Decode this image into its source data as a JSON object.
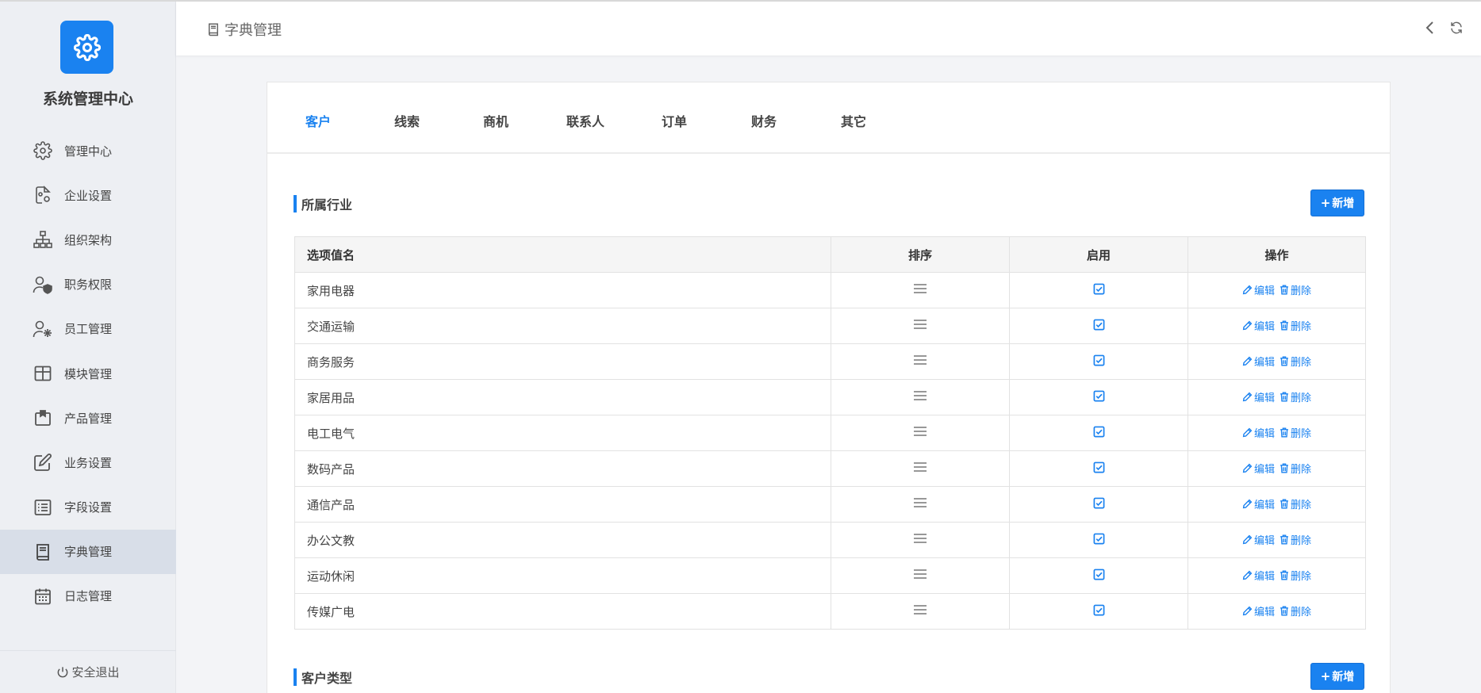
{
  "app": {
    "title": "系统管理中心",
    "logout": "安全退出"
  },
  "colors": {
    "accent": "#1a82f0",
    "sidebar_bg": "#edeff3",
    "sidebar_active": "#d8dee8"
  },
  "sidebar": {
    "items": [
      {
        "label": "管理中心",
        "icon": "gear-icon"
      },
      {
        "label": "企业设置",
        "icon": "document-gear-icon"
      },
      {
        "label": "组织架构",
        "icon": "org-chart-icon"
      },
      {
        "label": "职务权限",
        "icon": "user-shield-icon"
      },
      {
        "label": "员工管理",
        "icon": "user-gear-icon"
      },
      {
        "label": "模块管理",
        "icon": "grid-table-icon"
      },
      {
        "label": "产品管理",
        "icon": "box-icon"
      },
      {
        "label": "业务设置",
        "icon": "edit-icon"
      },
      {
        "label": "字段设置",
        "icon": "list-icon"
      },
      {
        "label": "字典管理",
        "icon": "book-icon",
        "active": true
      },
      {
        "label": "日志管理",
        "icon": "calendar-icon"
      }
    ]
  },
  "header": {
    "breadcrumb": "字典管理",
    "back_icon": "chevron-left-icon",
    "refresh_icon": "refresh-icon"
  },
  "tabs": [
    {
      "label": "客户",
      "active": true
    },
    {
      "label": "线索"
    },
    {
      "label": "商机"
    },
    {
      "label": "联系人"
    },
    {
      "label": "订单"
    },
    {
      "label": "财务"
    },
    {
      "label": "其它"
    }
  ],
  "sections": [
    {
      "title": "所属行业",
      "add_label": "新增",
      "columns": [
        "选项值名",
        "排序",
        "启用",
        "操作"
      ],
      "edit_label": "编辑",
      "delete_label": "删除",
      "rows": [
        {
          "name": "家用电器",
          "enabled": true
        },
        {
          "name": "交通运输",
          "enabled": true
        },
        {
          "name": "商务服务",
          "enabled": true
        },
        {
          "name": "家居用品",
          "enabled": true
        },
        {
          "name": "电工电气",
          "enabled": true
        },
        {
          "name": "数码产品",
          "enabled": true
        },
        {
          "name": "通信产品",
          "enabled": true
        },
        {
          "name": "办公文教",
          "enabled": true
        },
        {
          "name": "运动休闲",
          "enabled": true
        },
        {
          "name": "传媒广电",
          "enabled": true
        }
      ]
    },
    {
      "title": "客户类型",
      "add_label": "新增"
    }
  ]
}
